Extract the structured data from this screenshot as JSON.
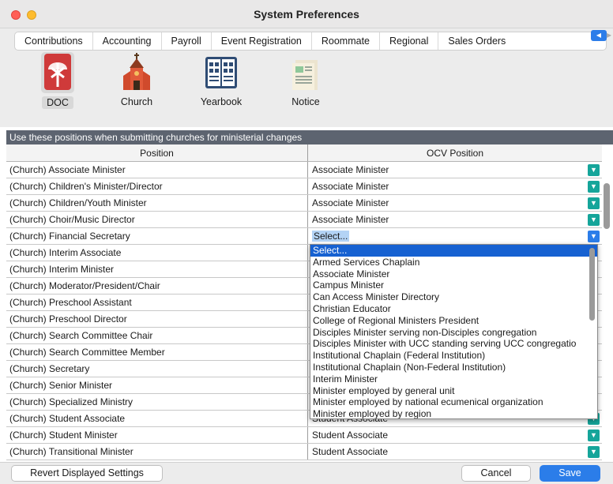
{
  "window": {
    "title": "System Preferences"
  },
  "tabs": [
    {
      "label": "Contributions"
    },
    {
      "label": "Accounting"
    },
    {
      "label": "Payroll"
    },
    {
      "label": "Event Registration"
    },
    {
      "label": "Roommate"
    },
    {
      "label": "Regional"
    },
    {
      "label": "Sales Orders"
    }
  ],
  "active_tab": "Regional",
  "subnav": [
    {
      "label": "DOC",
      "icon": "chalice-icon",
      "selected": true
    },
    {
      "label": "Church",
      "icon": "church-icon"
    },
    {
      "label": "Yearbook",
      "icon": "yearbook-icon"
    },
    {
      "label": "Notice",
      "icon": "notice-icon"
    }
  ],
  "section": {
    "header": "Use these positions when submitting churches for ministerial changes"
  },
  "columns": {
    "position": "Position",
    "ocv": "OCV Position"
  },
  "rows": [
    {
      "position": "(Church) Associate Minister",
      "ocv": "Associate Minister"
    },
    {
      "position": "(Church) Children's Minister/Director",
      "ocv": "Associate Minister"
    },
    {
      "position": "(Church) Children/Youth Minister",
      "ocv": "Associate Minister"
    },
    {
      "position": "(Church) Choir/Music Director",
      "ocv": "Associate Minister"
    },
    {
      "position": "(Church) Financial Secretary",
      "ocv": "Select..."
    },
    {
      "position": "(Church) Interim Associate",
      "ocv": ""
    },
    {
      "position": "(Church) Interim Minister",
      "ocv": ""
    },
    {
      "position": "(Church) Moderator/President/Chair",
      "ocv": ""
    },
    {
      "position": "(Church) Preschool Assistant",
      "ocv": ""
    },
    {
      "position": "(Church) Preschool Director",
      "ocv": ""
    },
    {
      "position": "(Church) Search Committee Chair",
      "ocv": ""
    },
    {
      "position": "(Church) Search Committee Member",
      "ocv": ""
    },
    {
      "position": "(Church) Secretary",
      "ocv": ""
    },
    {
      "position": "(Church) Senior Minister",
      "ocv": ""
    },
    {
      "position": "(Church) Specialized Ministry",
      "ocv": ""
    },
    {
      "position": "(Church) Student Associate",
      "ocv": "Student Associate"
    },
    {
      "position": "(Church) Student Minister",
      "ocv": "Student Associate"
    },
    {
      "position": "(Church) Transitional Minister",
      "ocv": "Student Associate"
    }
  ],
  "dropdown": {
    "options": [
      "Select...",
      "Armed Services Chaplain",
      "Associate Minister",
      "Campus Minister",
      "Can Access Minister Directory",
      "Christian Educator",
      "College of Regional Ministers President",
      "Disciples Minister serving non-Disciples congregation",
      "Disciples Minister with UCC standing serving UCC congregatio",
      "Institutional Chaplain (Federal Institution)",
      "Institutional Chaplain (Non-Federal Institution)",
      "Interim Minister",
      "Minister employed by general unit",
      "Minister employed by national ecumenical organization",
      "Minister employed by region"
    ],
    "selected": "Select..."
  },
  "footer": {
    "revert_label": "Revert Displayed Settings",
    "cancel_label": "Cancel",
    "save_label": "Save"
  },
  "colors": {
    "accent": "#2b7de9",
    "teal": "#15a59a",
    "header_bg": "#5d6470"
  }
}
